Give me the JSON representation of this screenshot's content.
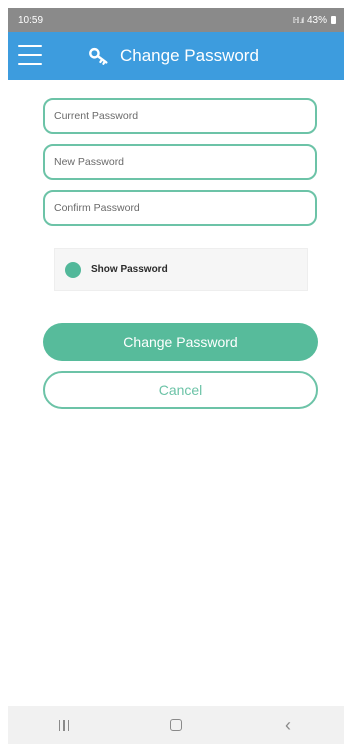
{
  "status_bar": {
    "time": "10:59",
    "signal": "ℍ .ıl",
    "battery": "43%"
  },
  "app_bar": {
    "title": "Change Password",
    "icon": "key-icon",
    "menu_icon": "hamburger-menu-icon",
    "background": "#3d9cde"
  },
  "form": {
    "current_password": {
      "placeholder": "Current Password",
      "value": ""
    },
    "new_password": {
      "placeholder": "New Password",
      "value": ""
    },
    "confirm_password": {
      "placeholder": "Confirm Password",
      "value": ""
    },
    "show_password_label": "Show Password"
  },
  "actions": {
    "change_password_label": "Change Password",
    "cancel_label": "Cancel"
  },
  "nav_bar": {
    "recents_icon": "recents-icon",
    "home_icon": "home-icon",
    "back_icon": "back-icon"
  },
  "colors": {
    "accent": "#57bb9b",
    "accent_border": "#6cc3a7",
    "app_bar": "#3d9cde"
  }
}
